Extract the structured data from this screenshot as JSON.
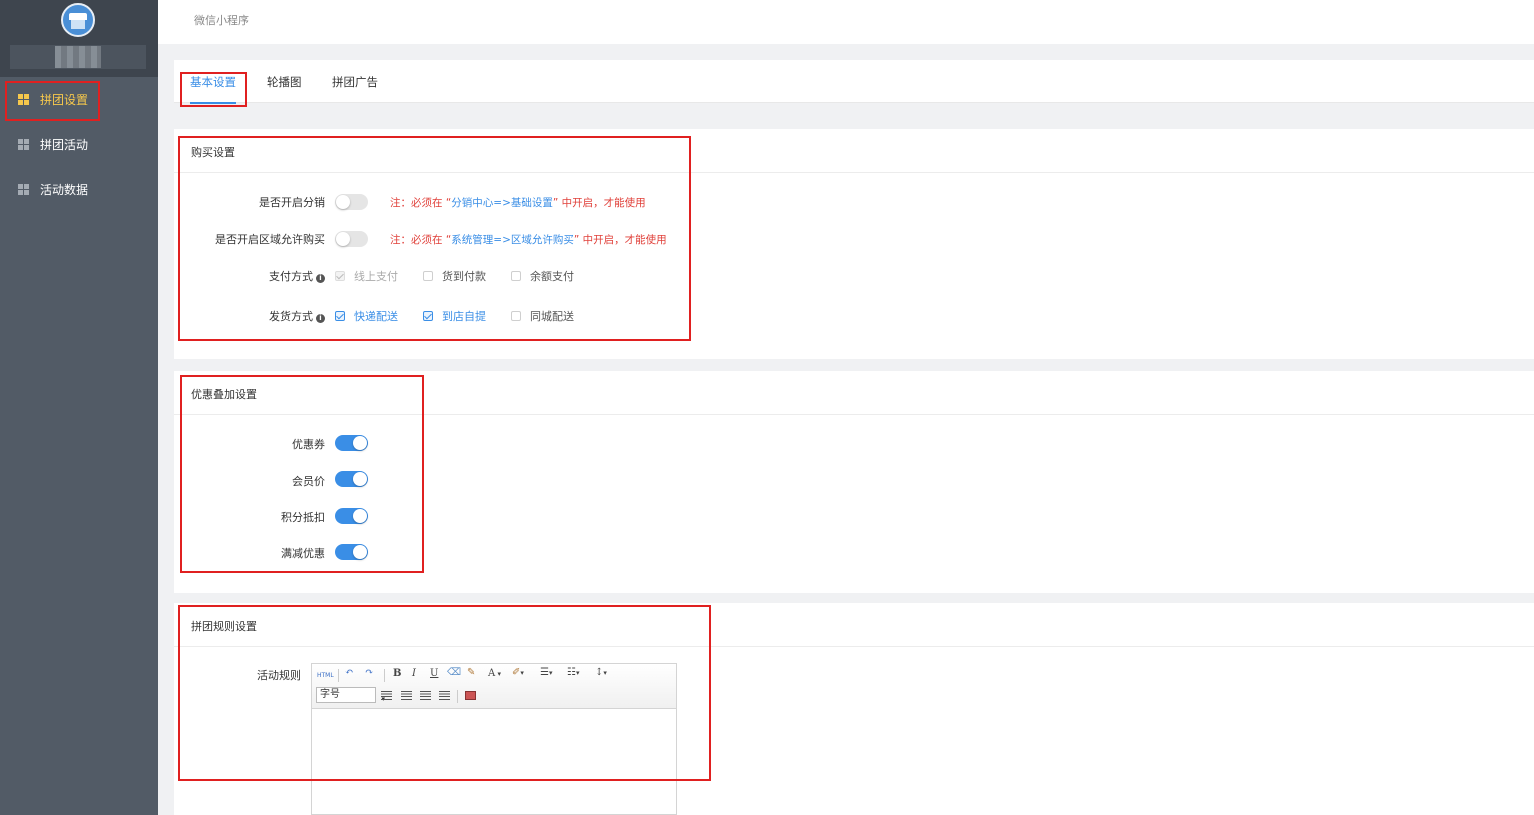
{
  "app": {
    "breadcrumb": "微信小程序",
    "username": ""
  },
  "sidebar": {
    "items": [
      {
        "label": "拼团设置",
        "active": true
      },
      {
        "label": "拼团活动",
        "active": false
      },
      {
        "label": "活动数据",
        "active": false
      }
    ]
  },
  "tabs": [
    {
      "label": "基本设置",
      "active": true
    },
    {
      "label": "轮播图",
      "active": false
    },
    {
      "label": "拼团广告",
      "active": false
    }
  ],
  "purchase": {
    "title": "购买设置",
    "distribution": {
      "label": "是否开启分销",
      "on": false,
      "note_prefix": "注：必须在 “",
      "note_link": "分销中心=>基础设置",
      "note_suffix": "” 中开启，才能使用"
    },
    "region": {
      "label": "是否开启区域允许购买",
      "on": false,
      "note_prefix": "注：必须在 “",
      "note_link": "系统管理=>区域允许购买",
      "note_suffix": "” 中开启，才能使用"
    },
    "payment": {
      "label": "支付方式",
      "options": [
        {
          "label": "线上支付",
          "checked": true,
          "disabled": true
        },
        {
          "label": "货到付款",
          "checked": false,
          "disabled": false
        },
        {
          "label": "余额支付",
          "checked": false,
          "disabled": false
        }
      ]
    },
    "delivery": {
      "label": "发货方式",
      "options": [
        {
          "label": "快递配送",
          "checked": true
        },
        {
          "label": "到店自提",
          "checked": true
        },
        {
          "label": "同城配送",
          "checked": false
        }
      ]
    }
  },
  "discount": {
    "title": "优惠叠加设置",
    "items": [
      {
        "label": "优惠券",
        "on": true
      },
      {
        "label": "会员价",
        "on": true
      },
      {
        "label": "积分抵扣",
        "on": true
      },
      {
        "label": "满减优惠",
        "on": true
      }
    ]
  },
  "rules": {
    "title": "拼团规则设置",
    "field_label": "活动规则",
    "editor": {
      "html_label": "HTML",
      "fontsize_label": "字号",
      "bold": "B",
      "italic": "I",
      "underline": "U",
      "font_color": "A",
      "content": ""
    }
  },
  "colors": {
    "accent": "#3a8ee6",
    "warning": "#e0403a",
    "sidebar": "#525b66",
    "active_nav": "#f6c84c"
  }
}
